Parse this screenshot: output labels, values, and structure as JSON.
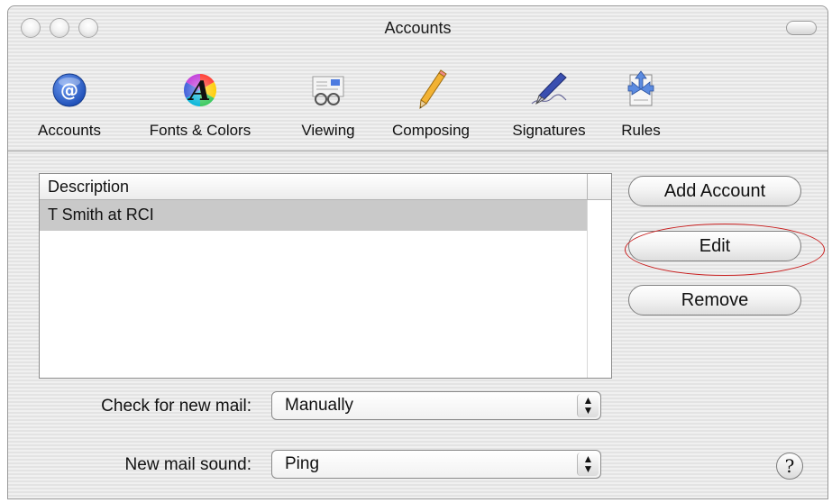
{
  "window": {
    "title": "Accounts"
  },
  "toolbar": {
    "items": [
      {
        "label": "Accounts",
        "icon": "at-sign-icon"
      },
      {
        "label": "Fonts & Colors",
        "icon": "font-color-icon"
      },
      {
        "label": "Viewing",
        "icon": "viewing-glasses-icon"
      },
      {
        "label": "Composing",
        "icon": "pencil-icon"
      },
      {
        "label": "Signatures",
        "icon": "fountain-pen-icon"
      },
      {
        "label": "Rules",
        "icon": "rules-arrows-icon"
      }
    ]
  },
  "accounts_table": {
    "column_header": "Description",
    "rows": [
      {
        "description": "T Smith at RCI",
        "selected": true
      }
    ]
  },
  "buttons": {
    "add_account": "Add Account",
    "edit": "Edit",
    "remove": "Remove"
  },
  "check_mail": {
    "label": "Check for new mail:",
    "value": "Manually"
  },
  "mail_sound": {
    "label": "New mail sound:",
    "value": "Ping"
  },
  "help": {
    "symbol": "?"
  },
  "colors": {
    "selection_row": "#c9c9c9",
    "highlight_ring": "#c81e1e",
    "accounts_icon": "#1f50b8"
  }
}
